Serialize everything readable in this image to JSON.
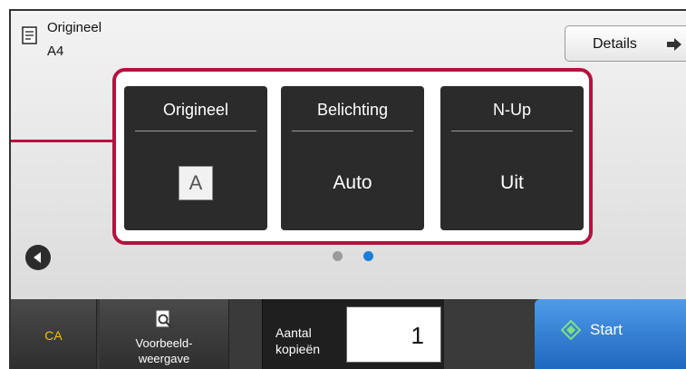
{
  "header": {
    "original_label": "Origineel",
    "original_size": "A4",
    "details_label": "Details"
  },
  "tiles": [
    {
      "title": "Origineel",
      "value": "A",
      "icon": "original-a-icon"
    },
    {
      "title": "Belichting",
      "value": "Auto"
    },
    {
      "title": "N-Up",
      "value": "Uit"
    }
  ],
  "pager": {
    "page_count": 2,
    "current_page": 2
  },
  "bottom": {
    "ca_label": "CA",
    "preview_label": "Voorbeeld-\nweergave",
    "copies_label": "Aantal\nkopieën",
    "copies_value": "1",
    "start_label": "Start"
  },
  "colors": {
    "highlight": "#b5123e",
    "tile": "#2b2b2b",
    "ca_text": "#f2c200",
    "start": "#2f7fd6",
    "active_dot": "#1c7ed6"
  }
}
